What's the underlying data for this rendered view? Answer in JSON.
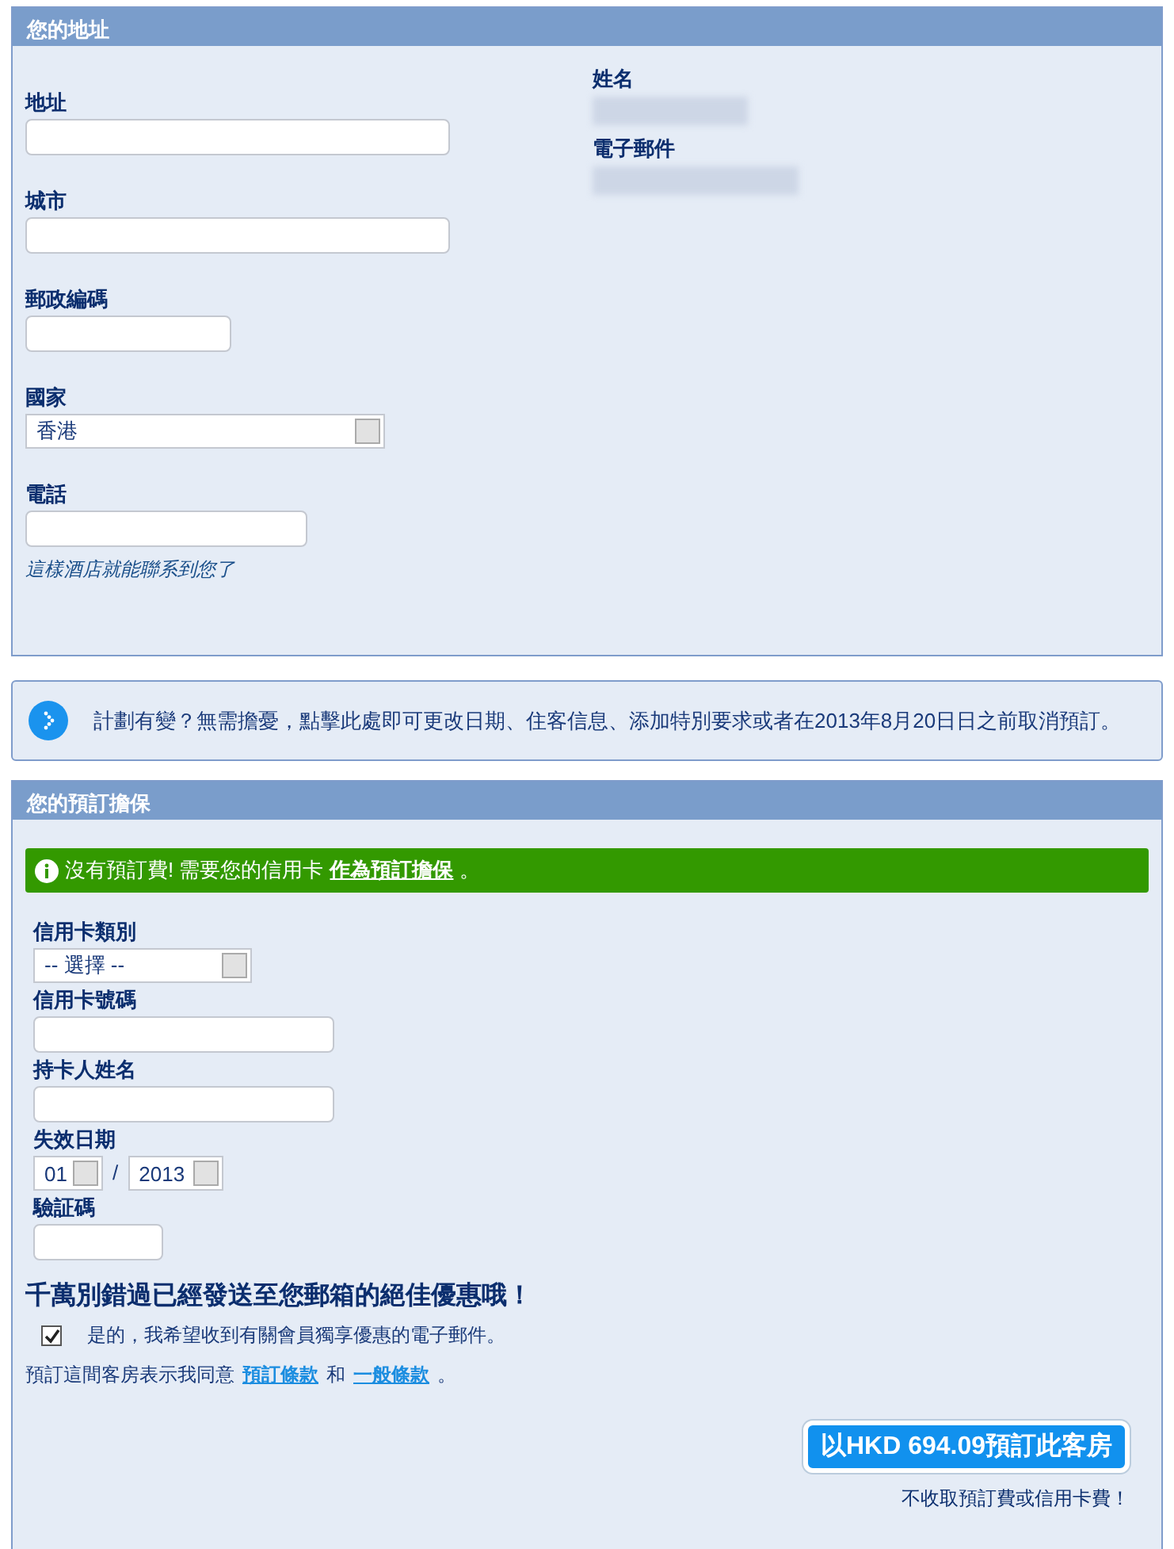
{
  "address_section": {
    "title": "您的地址",
    "fields": [
      {
        "kind": "text",
        "label": "地址"
      },
      {
        "kind": "text",
        "label": "城市"
      },
      {
        "kind": "text",
        "label": "郵政編碼"
      },
      {
        "kind": "select",
        "label": "國家",
        "value": "香港"
      },
      {
        "kind": "text",
        "label": "電話",
        "hint": "這樣酒店就能聯系到您了"
      }
    ],
    "guest": [
      {
        "label": "姓名"
      },
      {
        "label": "電子郵件"
      }
    ]
  },
  "notice": {
    "text": "計劃有變？無需擔憂，點擊此處即可更改日期、住客信息、添加特別要求或者在2013年8月20日日之前取消預訂。"
  },
  "guarantee_section": {
    "title": "您的預訂擔保",
    "banner": {
      "text": "沒有預訂費! 需要您的信用卡",
      "link": "作為預訂擔保",
      "tail": "。"
    },
    "fields": [
      {
        "kind": "select",
        "label": "信用卡類別",
        "value": "-- 選擇 --"
      },
      {
        "kind": "text",
        "label": "信用卡號碼"
      },
      {
        "kind": "text",
        "label": "持卡人姓名"
      },
      {
        "kind": "expiry",
        "label": "失效日期",
        "month": "01",
        "separator": "/",
        "year": "2013"
      },
      {
        "kind": "text",
        "label": "驗証碼"
      }
    ],
    "promo_title": "千萬別錯過已經發送至您郵箱的絕佳優惠哦！",
    "newsletter": {
      "checked": true,
      "label": "是的，我希望收到有關會員獨享優惠的電子郵件。"
    },
    "terms": {
      "text": "預訂這間客房表示我同意",
      "link_1": "預訂條款",
      "joiner": "和",
      "link_2": "一般條款",
      "tail": "。"
    },
    "book_button": "以HKD 694.09預訂此客房",
    "fee_note": "不收取預訂費或信用卡費！"
  }
}
